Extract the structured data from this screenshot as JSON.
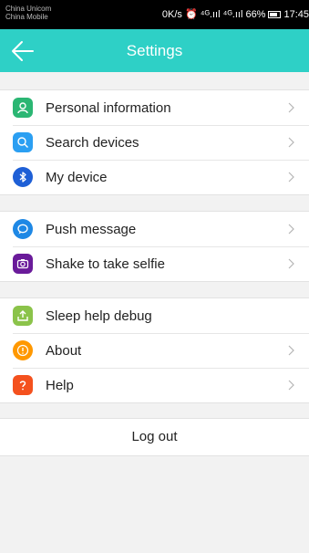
{
  "status_bar": {
    "carrier_1": "China Unicom",
    "carrier_2": "China Mobile",
    "right_text": "0K/s ⏰ ⁴ᴳ.ııl ⁴ᴳ.ııl 66%",
    "time": "17:45"
  },
  "header": {
    "title": "Settings",
    "back_icon": "arrow-left-icon"
  },
  "colors": {
    "accent": "#2ed0c6",
    "personal": "#2bb673",
    "search": "#2b9ff2",
    "device": "#1e5fd6",
    "push": "#1e88e5",
    "selfie": "#6a1b9a",
    "sleep": "#8bc34a",
    "about": "#ff9800",
    "help": "#f4511e"
  },
  "groups": [
    {
      "items": [
        {
          "label": "Personal information",
          "icon": "person-icon",
          "chevron": true
        },
        {
          "label": "Search devices",
          "icon": "search-icon",
          "chevron": true
        },
        {
          "label": "My device",
          "icon": "bluetooth-icon",
          "chevron": true
        }
      ]
    },
    {
      "items": [
        {
          "label": "Push message",
          "icon": "chat-bubble-icon",
          "chevron": true
        },
        {
          "label": "Shake to take selfie",
          "icon": "camera-icon",
          "chevron": true
        }
      ]
    },
    {
      "items": [
        {
          "label": "Sleep help debug",
          "icon": "upload-icon",
          "chevron": false
        },
        {
          "label": "About",
          "icon": "info-icon",
          "chevron": true
        },
        {
          "label": "Help",
          "icon": "question-icon",
          "chevron": true
        }
      ]
    }
  ],
  "logout_label": "Log out"
}
